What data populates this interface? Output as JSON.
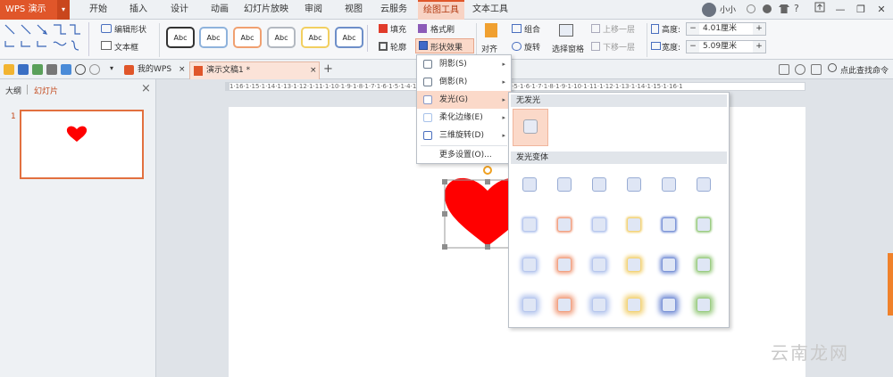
{
  "app": {
    "name": "WPS 演示",
    "arrow": "▾"
  },
  "menubar": {
    "tabs": [
      "开始",
      "插入",
      "设计",
      "动画",
      "幻灯片放映",
      "审阅",
      "视图",
      "云服务",
      "绘图工具",
      "文本工具"
    ],
    "active": "绘图工具",
    "user": "小小",
    "help": "?",
    "minimize": "—",
    "restore": "❐",
    "close": "✕"
  },
  "ribbon": {
    "edit_shape": "编辑形状",
    "text_box": "文本框",
    "style_label": "Abc",
    "fill": "填充",
    "outline": "轮廓",
    "format_painter": "格式刷",
    "shape_effects": "形状效果",
    "align": "对齐",
    "group": "组合",
    "rotate": "旋转",
    "select_pane": "选择窗格",
    "bring_forward": "上移一层",
    "send_backward": "下移一层",
    "height_label": "高度:",
    "height_value": "4.01厘米",
    "width_label": "宽度:",
    "width_value": "5.09厘米",
    "minus": "−",
    "plus": "+"
  },
  "toolbar": {
    "tab_mywps": "我的WPS",
    "tab_doc": "演示文稿1 *",
    "close": "×",
    "new_tab": "+",
    "search": "点此查找命令"
  },
  "left_panel": {
    "tab_outline": "大纲",
    "tab_slides": "幻灯片",
    "close": "×",
    "slide_number": "1"
  },
  "ruler": {
    "text": "1·16·1·15·1·14·1·13·1·12·1·11·1·10·1·9·1·8·1·7·1·6·1·5·1·4·1·3·1·2·1·1·1·0·1·1·1·2·1·3·1·4·1·5·1·6·1·7·1·8·1·9·1·10·1·11·1·12·1·13·1·14·1·15·1·16·1"
  },
  "effects_menu": {
    "items": [
      "阴影(S)",
      "倒影(R)",
      "发光(G)",
      "柔化边缘(E)",
      "三维旋转(D)"
    ],
    "highlighted": "发光(G)",
    "more": "更多设置(O)...",
    "chevron": "▸"
  },
  "glow_panel": {
    "no_glow": "无发光",
    "variants": "发光变体",
    "glow_colors": [
      "#b7c7ee",
      "#f2a283",
      "#b7c7ee",
      "#f3d47a",
      "#7d95d8",
      "#9ccc83"
    ]
  },
  "colors": {
    "accent": "#e0562a",
    "heart": "#ff0000",
    "selection": "#888888"
  },
  "watermark": "云南龙网"
}
